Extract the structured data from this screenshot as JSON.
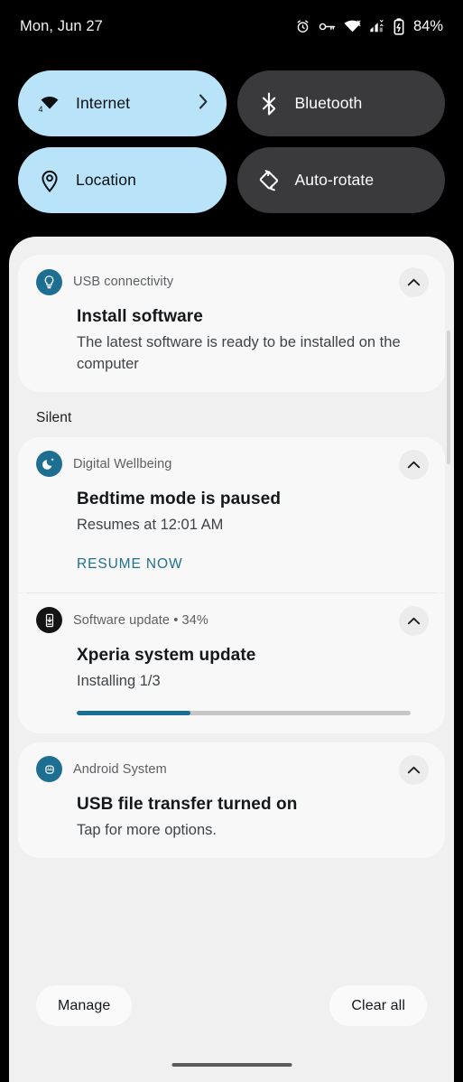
{
  "status_bar": {
    "date": "Mon, Jun 27",
    "battery_percent": "84%",
    "icons": [
      "alarm-icon",
      "vpn-key-icon",
      "wifi-icon",
      "cell-signal-icon",
      "battery-charging-icon"
    ]
  },
  "quick_settings": {
    "tiles": [
      {
        "label": "Internet",
        "icon": "wifi-4g-icon",
        "state": "on",
        "has_chevron": true
      },
      {
        "label": "Bluetooth",
        "icon": "bluetooth-icon",
        "state": "off",
        "has_chevron": false
      },
      {
        "label": "Location",
        "icon": "location-pin-icon",
        "state": "on",
        "has_chevron": false
      },
      {
        "label": "Auto-rotate",
        "icon": "auto-rotate-icon",
        "state": "off",
        "has_chevron": false
      }
    ]
  },
  "notifications": {
    "silent_section_label": "Silent",
    "items": [
      {
        "app": "USB connectivity",
        "icon": "lightbulb-icon",
        "title": "Install software",
        "body": "The latest software is ready to be installed on the computer",
        "expand_icon": "chevron-up-icon"
      },
      {
        "app": "Digital Wellbeing",
        "icon": "bedtime-moon-icon",
        "title": "Bedtime mode is paused",
        "body": "Resumes at 12:01 AM",
        "action_label": "RESUME NOW",
        "expand_icon": "chevron-up-icon"
      },
      {
        "app": "Software update • 34%",
        "icon": "system-update-icon",
        "title": "Xperia system update",
        "body": "Installing 1/3",
        "progress_percent": 34,
        "expand_icon": "chevron-up-icon"
      },
      {
        "app": "Android System",
        "icon": "android-robot-icon",
        "title": "USB file transfer turned on",
        "body": "Tap for more options.",
        "expand_icon": "chevron-up-icon"
      }
    ]
  },
  "footer": {
    "manage_label": "Manage",
    "clear_all_label": "Clear all"
  },
  "colors": {
    "tile_on": "#b9e3f9",
    "tile_off": "#3a3a3c",
    "accent_teal": "#1d6e91",
    "action_teal": "#21708f",
    "progress_fill": "#1a6e94",
    "panel_bg": "#f0f0f0",
    "card_bg": "#f8f8f8"
  }
}
